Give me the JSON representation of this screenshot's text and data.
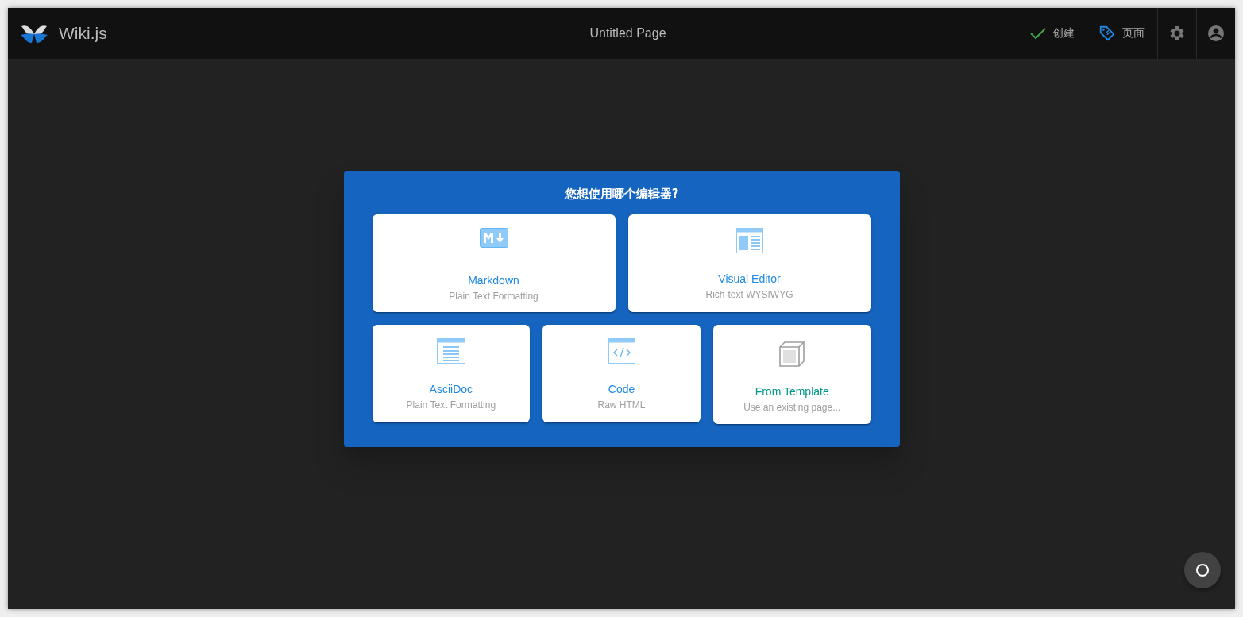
{
  "header": {
    "logo_text": "Wiki.js",
    "title": "Untitled Page",
    "actions": [
      {
        "kind": "create",
        "label": "创建"
      },
      {
        "kind": "page",
        "label": "页面"
      }
    ]
  },
  "dialog": {
    "title": "您想使用哪个编辑器?",
    "rows": [
      [
        {
          "kind": "markdown",
          "title": "Markdown",
          "subtitle": "Plain Text Formatting"
        },
        {
          "kind": "visual",
          "title": "Visual Editor",
          "subtitle": "Rich-text WYSIWYG"
        }
      ],
      [
        {
          "kind": "asciidoc",
          "title": "AsciiDoc",
          "subtitle": "Plain Text Formatting"
        },
        {
          "kind": "code",
          "title": "Code",
          "subtitle": "Raw HTML"
        },
        {
          "kind": "template",
          "title": "From Template",
          "subtitle": "Use an existing page..."
        }
      ]
    ]
  }
}
